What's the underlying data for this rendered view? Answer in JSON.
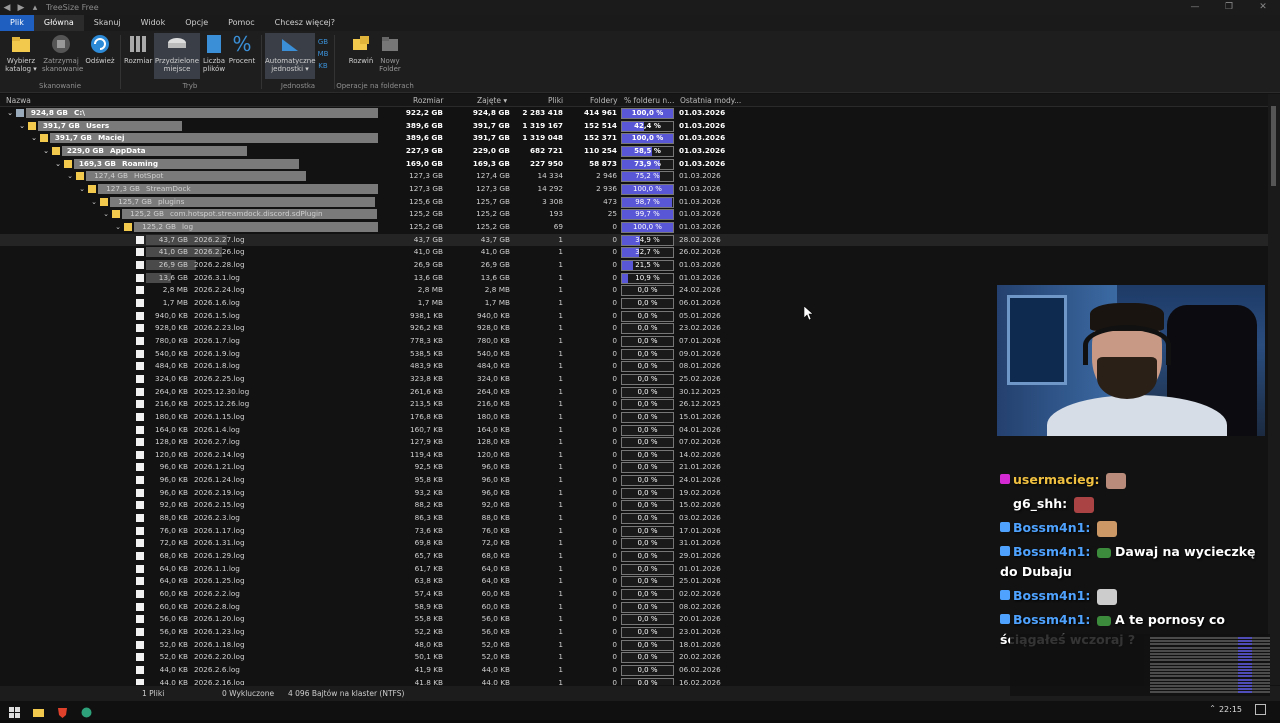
{
  "titlebar": {
    "title": "TreeSize Free"
  },
  "menubar": {
    "items": [
      "Plik",
      "Główna",
      "Skanuj",
      "Widok",
      "Opcje",
      "Pomoc",
      "Chcesz więcej?"
    ]
  },
  "ribbon": {
    "buttons": [
      {
        "label": "Wybierz katalog ▾",
        "icon": "folder-open-icon"
      },
      {
        "label": "Zatrzymaj skanowanie",
        "icon": "stop-icon"
      },
      {
        "label": "Odśwież",
        "icon": "refresh-icon"
      },
      {
        "label": "Rozmiar",
        "icon": "size-icon"
      },
      {
        "label": "Przydzielone miejsce",
        "icon": "allocated-space-icon"
      },
      {
        "label": "Liczba plików",
        "icon": "file-count-icon"
      },
      {
        "label": "Procent",
        "icon": "percent-icon"
      },
      {
        "label": "Automatyczne jednostki ▾",
        "icon": "auto-units-icon"
      },
      {
        "label": "Rozwiń",
        "icon": "expand-icon"
      },
      {
        "label": "Nowy Folder",
        "icon": "new-folder-icon"
      }
    ],
    "unit_labels": [
      "GB",
      "MB",
      "KB"
    ],
    "groups": [
      "Skanowanie",
      "Tryb",
      "Jednostka",
      "Operacje na folderach"
    ]
  },
  "columns": {
    "name": "Nazwa",
    "size": "Rozmiar",
    "allocated": "Zajęte ▾",
    "files": "Pliki",
    "folders": "Foldery",
    "percent": "% folderu n...",
    "modified": "Ostatnia mody..."
  },
  "rows": [
    {
      "level": 0,
      "type": "drive",
      "twisty": "⌄",
      "label_size": "924,8 GB",
      "name": "C:\\",
      "size": "922,2 GB",
      "alloc": "924,8 GB",
      "files": "2 283 418",
      "folders": "414 961",
      "pct": 100.0,
      "pct_text": "100,0 %",
      "date": "01.03.2026",
      "bold": true,
      "sizebar": 1.0
    },
    {
      "level": 1,
      "type": "folder",
      "twisty": "⌄",
      "label_size": "391,7 GB",
      "name": "Users",
      "size": "389,6 GB",
      "alloc": "391,7 GB",
      "files": "1 319 167",
      "folders": "152 514",
      "pct": 42.4,
      "pct_text": "42,4 %",
      "date": "01.03.2026",
      "bold": true,
      "sizebar": 0.424
    },
    {
      "level": 2,
      "type": "folder",
      "twisty": "⌄",
      "label_size": "391,7 GB",
      "name": "Maciej",
      "size": "389,6 GB",
      "alloc": "391,7 GB",
      "files": "1 319 048",
      "folders": "152 371",
      "pct": 100.0,
      "pct_text": "100,0 %",
      "date": "01.03.2026",
      "bold": true,
      "sizebar": 1.0
    },
    {
      "level": 3,
      "type": "folder",
      "twisty": "⌄",
      "label_size": "229,0 GB",
      "name": "AppData",
      "size": "227,9 GB",
      "alloc": "229,0 GB",
      "files": "682 721",
      "folders": "110 254",
      "pct": 58.5,
      "pct_text": "58,5 %",
      "date": "01.03.2026",
      "bold": true,
      "sizebar": 0.585
    },
    {
      "level": 4,
      "type": "folder",
      "twisty": "⌄",
      "label_size": "169,3 GB",
      "name": "Roaming",
      "size": "169,0 GB",
      "alloc": "169,3 GB",
      "files": "227 950",
      "folders": "58 873",
      "pct": 73.9,
      "pct_text": "73,9 %",
      "date": "01.03.2026",
      "bold": true,
      "sizebar": 0.739
    },
    {
      "level": 5,
      "type": "folder",
      "twisty": "⌄",
      "label_size": "127,4 GB",
      "name": "HotSpot",
      "size": "127,3 GB",
      "alloc": "127,4 GB",
      "files": "14 334",
      "folders": "2 946",
      "pct": 75.2,
      "pct_text": "75,2 %",
      "date": "01.03.2026",
      "bold": false,
      "sizebar": 0.752
    },
    {
      "level": 6,
      "type": "folder",
      "twisty": "⌄",
      "label_size": "127,3 GB",
      "name": "StreamDock",
      "size": "127,3 GB",
      "alloc": "127,3 GB",
      "files": "14 292",
      "folders": "2 936",
      "pct": 100.0,
      "pct_text": "100,0 %",
      "date": "01.03.2026",
      "bold": false,
      "sizebar": 1.0
    },
    {
      "level": 7,
      "type": "folder",
      "twisty": "⌄",
      "label_size": "125,7 GB",
      "name": "plugins",
      "size": "125,6 GB",
      "alloc": "125,7 GB",
      "files": "3 308",
      "folders": "473",
      "pct": 98.7,
      "pct_text": "98,7 %",
      "date": "01.03.2026",
      "bold": false,
      "sizebar": 0.987
    },
    {
      "level": 8,
      "type": "folder",
      "twisty": "⌄",
      "label_size": "125,2 GB",
      "name": "com.hotspot.streamdock.discord.sdPlugin",
      "size": "125,2 GB",
      "alloc": "125,2 GB",
      "files": "193",
      "folders": "25",
      "pct": 99.7,
      "pct_text": "99,7 %",
      "date": "01.03.2026",
      "bold": false,
      "sizebar": 0.997
    },
    {
      "level": 9,
      "type": "folder",
      "twisty": "⌄",
      "label_size": "125,2 GB",
      "name": "log",
      "size": "125,2 GB",
      "alloc": "125,2 GB",
      "files": "69",
      "folders": "0",
      "pct": 100.0,
      "pct_text": "100,0 %",
      "date": "01.03.2026",
      "bold": false,
      "sizebar": 1.0
    },
    {
      "level": 10,
      "type": "file",
      "label_size": "43,7 GB",
      "name": "2026.2.27.log",
      "size": "43,7 GB",
      "alloc": "43,7 GB",
      "files": "1",
      "folders": "0",
      "pct": 34.9,
      "pct_text": "34,9 %",
      "date": "28.02.2026",
      "bold": false,
      "sizebar": 0.349,
      "selected": true
    },
    {
      "level": 10,
      "type": "file",
      "label_size": "41,0 GB",
      "name": "2026.2.26.log",
      "size": "41,0 GB",
      "alloc": "41,0 GB",
      "files": "1",
      "folders": "0",
      "pct": 32.7,
      "pct_text": "32,7 %",
      "date": "26.02.2026",
      "bold": false,
      "sizebar": 0.327
    },
    {
      "level": 10,
      "type": "file",
      "label_size": "26,9 GB",
      "name": "2026.2.28.log",
      "size": "26,9 GB",
      "alloc": "26,9 GB",
      "files": "1",
      "folders": "0",
      "pct": 21.5,
      "pct_text": "21,5 %",
      "date": "01.03.2026",
      "bold": false,
      "sizebar": 0.215
    },
    {
      "level": 10,
      "type": "file",
      "label_size": "13,6 GB",
      "name": "2026.3.1.log",
      "size": "13,6 GB",
      "alloc": "13,6 GB",
      "files": "1",
      "folders": "0",
      "pct": 10.9,
      "pct_text": "10,9 %",
      "date": "01.03.2026",
      "bold": false,
      "sizebar": 0.109
    },
    {
      "level": 10,
      "type": "file",
      "label_size": "2,8 MB",
      "name": "2026.2.24.log",
      "size": "2,8 MB",
      "alloc": "2,8 MB",
      "files": "1",
      "folders": "0",
      "pct": 0,
      "pct_text": "0,0 %",
      "date": "24.02.2026",
      "bold": false,
      "sizebar": 0
    },
    {
      "level": 10,
      "type": "file",
      "label_size": "1,7 MB",
      "name": "2026.1.6.log",
      "size": "1,7 MB",
      "alloc": "1,7 MB",
      "files": "1",
      "folders": "0",
      "pct": 0,
      "pct_text": "0,0 %",
      "date": "06.01.2026",
      "bold": false,
      "sizebar": 0
    },
    {
      "level": 10,
      "type": "file",
      "label_size": "940,0 KB",
      "name": "2026.1.5.log",
      "size": "938,1 KB",
      "alloc": "940,0 KB",
      "files": "1",
      "folders": "0",
      "pct": 0,
      "pct_text": "0,0 %",
      "date": "05.01.2026",
      "bold": false,
      "sizebar": 0
    },
    {
      "level": 10,
      "type": "file",
      "label_size": "928,0 KB",
      "name": "2026.2.23.log",
      "size": "926,2 KB",
      "alloc": "928,0 KB",
      "files": "1",
      "folders": "0",
      "pct": 0,
      "pct_text": "0,0 %",
      "date": "23.02.2026",
      "bold": false,
      "sizebar": 0
    },
    {
      "level": 10,
      "type": "file",
      "label_size": "780,0 KB",
      "name": "2026.1.7.log",
      "size": "778,3 KB",
      "alloc": "780,0 KB",
      "files": "1",
      "folders": "0",
      "pct": 0,
      "pct_text": "0,0 %",
      "date": "07.01.2026",
      "bold": false,
      "sizebar": 0
    },
    {
      "level": 10,
      "type": "file",
      "label_size": "540,0 KB",
      "name": "2026.1.9.log",
      "size": "538,5 KB",
      "alloc": "540,0 KB",
      "files": "1",
      "folders": "0",
      "pct": 0,
      "pct_text": "0,0 %",
      "date": "09.01.2026",
      "bold": false,
      "sizebar": 0
    },
    {
      "level": 10,
      "type": "file",
      "label_size": "484,0 KB",
      "name": "2026.1.8.log",
      "size": "483,9 KB",
      "alloc": "484,0 KB",
      "files": "1",
      "folders": "0",
      "pct": 0,
      "pct_text": "0,0 %",
      "date": "08.01.2026",
      "bold": false,
      "sizebar": 0
    },
    {
      "level": 10,
      "type": "file",
      "label_size": "324,0 KB",
      "name": "2026.2.25.log",
      "size": "323,8 KB",
      "alloc": "324,0 KB",
      "files": "1",
      "folders": "0",
      "pct": 0,
      "pct_text": "0,0 %",
      "date": "25.02.2026",
      "bold": false,
      "sizebar": 0
    },
    {
      "level": 10,
      "type": "file",
      "label_size": "264,0 KB",
      "name": "2025.12.30.log",
      "size": "261,6 KB",
      "alloc": "264,0 KB",
      "files": "1",
      "folders": "0",
      "pct": 0,
      "pct_text": "0,0 %",
      "date": "30.12.2025",
      "bold": false,
      "sizebar": 0
    },
    {
      "level": 10,
      "type": "file",
      "label_size": "216,0 KB",
      "name": "2025.12.26.log",
      "size": "213,5 KB",
      "alloc": "216,0 KB",
      "files": "1",
      "folders": "0",
      "pct": 0,
      "pct_text": "0,0 %",
      "date": "26.12.2025",
      "bold": false,
      "sizebar": 0
    },
    {
      "level": 10,
      "type": "file",
      "label_size": "180,0 KB",
      "name": "2026.1.15.log",
      "size": "176,8 KB",
      "alloc": "180,0 KB",
      "files": "1",
      "folders": "0",
      "pct": 0,
      "pct_text": "0,0 %",
      "date": "15.01.2026",
      "bold": false,
      "sizebar": 0
    },
    {
      "level": 10,
      "type": "file",
      "label_size": "164,0 KB",
      "name": "2026.1.4.log",
      "size": "160,7 KB",
      "alloc": "164,0 KB",
      "files": "1",
      "folders": "0",
      "pct": 0,
      "pct_text": "0,0 %",
      "date": "04.01.2026",
      "bold": false,
      "sizebar": 0
    },
    {
      "level": 10,
      "type": "file",
      "label_size": "128,0 KB",
      "name": "2026.2.7.log",
      "size": "127,9 KB",
      "alloc": "128,0 KB",
      "files": "1",
      "folders": "0",
      "pct": 0,
      "pct_text": "0,0 %",
      "date": "07.02.2026",
      "bold": false,
      "sizebar": 0
    },
    {
      "level": 10,
      "type": "file",
      "label_size": "120,0 KB",
      "name": "2026.2.14.log",
      "size": "119,4 KB",
      "alloc": "120,0 KB",
      "files": "1",
      "folders": "0",
      "pct": 0,
      "pct_text": "0,0 %",
      "date": "14.02.2026",
      "bold": false,
      "sizebar": 0
    },
    {
      "level": 10,
      "type": "file",
      "label_size": "96,0 KB",
      "name": "2026.1.21.log",
      "size": "92,5 KB",
      "alloc": "96,0 KB",
      "files": "1",
      "folders": "0",
      "pct": 0,
      "pct_text": "0,0 %",
      "date": "21.01.2026",
      "bold": false,
      "sizebar": 0
    },
    {
      "level": 10,
      "type": "file",
      "label_size": "96,0 KB",
      "name": "2026.1.24.log",
      "size": "95,8 KB",
      "alloc": "96,0 KB",
      "files": "1",
      "folders": "0",
      "pct": 0,
      "pct_text": "0,0 %",
      "date": "24.01.2026",
      "bold": false,
      "sizebar": 0
    },
    {
      "level": 10,
      "type": "file",
      "label_size": "96,0 KB",
      "name": "2026.2.19.log",
      "size": "93,2 KB",
      "alloc": "96,0 KB",
      "files": "1",
      "folders": "0",
      "pct": 0,
      "pct_text": "0,0 %",
      "date": "19.02.2026",
      "bold": false,
      "sizebar": 0
    },
    {
      "level": 10,
      "type": "file",
      "label_size": "92,0 KB",
      "name": "2026.2.15.log",
      "size": "88,2 KB",
      "alloc": "92,0 KB",
      "files": "1",
      "folders": "0",
      "pct": 0,
      "pct_text": "0,0 %",
      "date": "15.02.2026",
      "bold": false,
      "sizebar": 0
    },
    {
      "level": 10,
      "type": "file",
      "label_size": "88,0 KB",
      "name": "2026.2.3.log",
      "size": "86,3 KB",
      "alloc": "88,0 KB",
      "files": "1",
      "folders": "0",
      "pct": 0,
      "pct_text": "0,0 %",
      "date": "03.02.2026",
      "bold": false,
      "sizebar": 0
    },
    {
      "level": 10,
      "type": "file",
      "label_size": "76,0 KB",
      "name": "2026.1.17.log",
      "size": "73,6 KB",
      "alloc": "76,0 KB",
      "files": "1",
      "folders": "0",
      "pct": 0,
      "pct_text": "0,0 %",
      "date": "17.01.2026",
      "bold": false,
      "sizebar": 0
    },
    {
      "level": 10,
      "type": "file",
      "label_size": "72,0 KB",
      "name": "2026.1.31.log",
      "size": "69,8 KB",
      "alloc": "72,0 KB",
      "files": "1",
      "folders": "0",
      "pct": 0,
      "pct_text": "0,0 %",
      "date": "31.01.2026",
      "bold": false,
      "sizebar": 0
    },
    {
      "level": 10,
      "type": "file",
      "label_size": "68,0 KB",
      "name": "2026.1.29.log",
      "size": "65,7 KB",
      "alloc": "68,0 KB",
      "files": "1",
      "folders": "0",
      "pct": 0,
      "pct_text": "0,0 %",
      "date": "29.01.2026",
      "bold": false,
      "sizebar": 0
    },
    {
      "level": 10,
      "type": "file",
      "label_size": "64,0 KB",
      "name": "2026.1.1.log",
      "size": "61,7 KB",
      "alloc": "64,0 KB",
      "files": "1",
      "folders": "0",
      "pct": 0,
      "pct_text": "0,0 %",
      "date": "01.01.2026",
      "bold": false,
      "sizebar": 0
    },
    {
      "level": 10,
      "type": "file",
      "label_size": "64,0 KB",
      "name": "2026.1.25.log",
      "size": "63,8 KB",
      "alloc": "64,0 KB",
      "files": "1",
      "folders": "0",
      "pct": 0,
      "pct_text": "0,0 %",
      "date": "25.01.2026",
      "bold": false,
      "sizebar": 0
    },
    {
      "level": 10,
      "type": "file",
      "label_size": "60,0 KB",
      "name": "2026.2.2.log",
      "size": "57,4 KB",
      "alloc": "60,0 KB",
      "files": "1",
      "folders": "0",
      "pct": 0,
      "pct_text": "0,0 %",
      "date": "02.02.2026",
      "bold": false,
      "sizebar": 0
    },
    {
      "level": 10,
      "type": "file",
      "label_size": "60,0 KB",
      "name": "2026.2.8.log",
      "size": "58,9 KB",
      "alloc": "60,0 KB",
      "files": "1",
      "folders": "0",
      "pct": 0,
      "pct_text": "0,0 %",
      "date": "08.02.2026",
      "bold": false,
      "sizebar": 0
    },
    {
      "level": 10,
      "type": "file",
      "label_size": "56,0 KB",
      "name": "2026.1.20.log",
      "size": "55,8 KB",
      "alloc": "56,0 KB",
      "files": "1",
      "folders": "0",
      "pct": 0,
      "pct_text": "0,0 %",
      "date": "20.01.2026",
      "bold": false,
      "sizebar": 0
    },
    {
      "level": 10,
      "type": "file",
      "label_size": "56,0 KB",
      "name": "2026.1.23.log",
      "size": "52,2 KB",
      "alloc": "56,0 KB",
      "files": "1",
      "folders": "0",
      "pct": 0,
      "pct_text": "0,0 %",
      "date": "23.01.2026",
      "bold": false,
      "sizebar": 0
    },
    {
      "level": 10,
      "type": "file",
      "label_size": "52,0 KB",
      "name": "2026.1.18.log",
      "size": "48,0 KB",
      "alloc": "52,0 KB",
      "files": "1",
      "folders": "0",
      "pct": 0,
      "pct_text": "0,0 %",
      "date": "18.01.2026",
      "bold": false,
      "sizebar": 0
    },
    {
      "level": 10,
      "type": "file",
      "label_size": "52,0 KB",
      "name": "2026.2.20.log",
      "size": "50,1 KB",
      "alloc": "52,0 KB",
      "files": "1",
      "folders": "0",
      "pct": 0,
      "pct_text": "0,0 %",
      "date": "20.02.2026",
      "bold": false,
      "sizebar": 0
    },
    {
      "level": 10,
      "type": "file",
      "label_size": "44,0 KB",
      "name": "2026.2.6.log",
      "size": "41,9 KB",
      "alloc": "44,0 KB",
      "files": "1",
      "folders": "0",
      "pct": 0,
      "pct_text": "0,0 %",
      "date": "06.02.2026",
      "bold": false,
      "sizebar": 0
    },
    {
      "level": 10,
      "type": "file",
      "label_size": "44,0 KB",
      "name": "2026.2.16.log",
      "size": "41,8 KB",
      "alloc": "44,0 KB",
      "files": "1",
      "folders": "0",
      "pct": 0,
      "pct_text": "0,0 %",
      "date": "16.02.2026",
      "bold": false,
      "sizebar": 0
    }
  ],
  "status": {
    "files": "1 Pliki",
    "excluded": "0 Wykluczone",
    "cluster": "4 096 Bajtów na klaster (NTFS)"
  },
  "taskbar": {
    "time": "22:15"
  },
  "chat": [
    {
      "user": "usermacieg:",
      "text": "",
      "color": "#f0c040"
    },
    {
      "user": "g6_shh:",
      "text": "",
      "color": "#ffffff"
    },
    {
      "user": "Bossm4n1:",
      "text": "",
      "color": "#4fa3ff"
    },
    {
      "user": "Bossm4n1:",
      "text": "Dawaj na wycieczkę do Dubaju",
      "color": "#4fa3ff"
    },
    {
      "user": "Bossm4n1:",
      "text": "",
      "color": "#4fa3ff"
    },
    {
      "user": "Bossm4n1:",
      "text": "A te pornosy co ściągałeś wczoraj ?",
      "color": "#4fa3ff"
    }
  ]
}
